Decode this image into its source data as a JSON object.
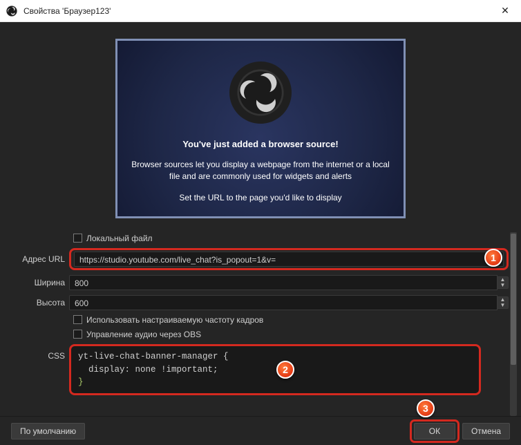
{
  "window": {
    "title": "Свойства 'Браузер123'"
  },
  "preview": {
    "line1": "You've just added a browser source!",
    "line2": "Browser sources let you display a webpage from the internet or a local file and are commonly used for widgets and alerts",
    "line3": "Set the URL to the page you'd like to display"
  },
  "labels": {
    "local_file": "Локальный файл",
    "url": "Адрес URL",
    "width": "Ширина",
    "height": "Высота",
    "custom_fps": "Использовать настраиваемую частоту кадров",
    "audio_obs": "Управление аудио через OBS",
    "css": "CSS"
  },
  "values": {
    "url": "https://studio.youtube.com/live_chat?is_popout=1&v=",
    "width": "800",
    "height": "600",
    "css_line1": "yt-live-chat-banner-manager {",
    "css_line2": "  display: none !important;",
    "css_line3": "}"
  },
  "buttons": {
    "defaults": "По умолчанию",
    "ok": "ОК",
    "cancel": "Отмена"
  },
  "annotations": {
    "b1": "1",
    "b2": "2",
    "b3": "3"
  }
}
